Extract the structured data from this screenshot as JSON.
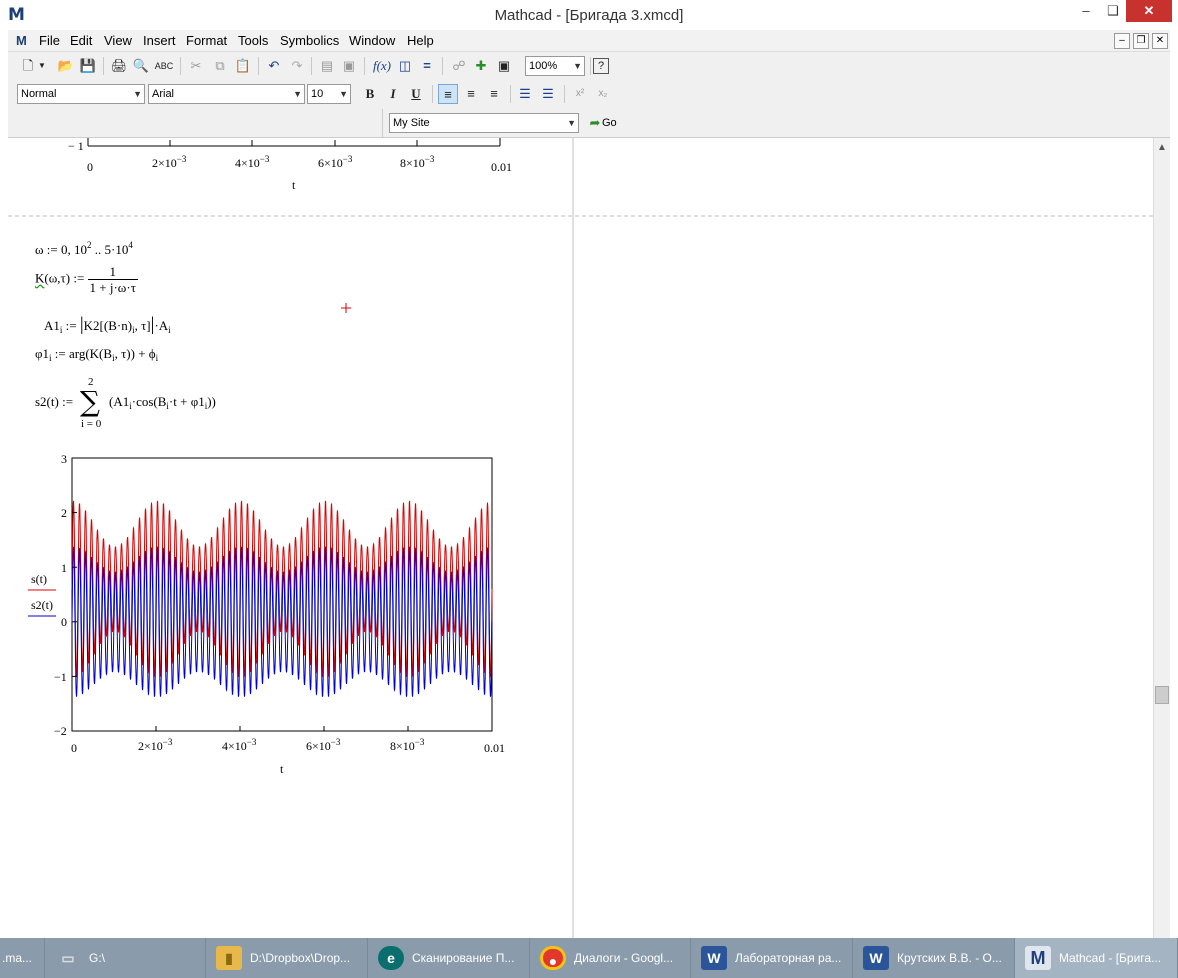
{
  "window": {
    "title": "Mathcad - [Бригада 3.xmcd]",
    "app_icon": "mathcad-m-icon"
  },
  "menu": {
    "items": [
      "File",
      "Edit",
      "View",
      "Insert",
      "Format",
      "Tools",
      "Symbolics",
      "Window",
      "Help"
    ]
  },
  "toolbar": {
    "zoom": "100%",
    "style": "Normal",
    "font": "Arial",
    "size": "10",
    "bold": "B",
    "italic": "I",
    "underline": "U",
    "site": "My Site",
    "go": "Go",
    "superscript": "x²",
    "subscript": "x₂"
  },
  "top_plot": {
    "y_tick": "− 1",
    "x_ticks": [
      {
        "mant": "0",
        "exp": ""
      },
      {
        "mant": "2×10",
        "exp": "−3"
      },
      {
        "mant": "4×10",
        "exp": "−3"
      },
      {
        "mant": "6×10",
        "exp": "−3"
      },
      {
        "mant": "8×10",
        "exp": "−3"
      },
      {
        "mant": "0.01",
        "exp": ""
      }
    ],
    "xlabel": "t"
  },
  "equations": {
    "omega": {
      "lhs": "ω := 0, 10",
      "exp1": "2",
      "mid": " .. 5·10",
      "exp2": "4"
    },
    "K": {
      "lhs": "K",
      "args": "(ω,τ) := ",
      "num": "1",
      "den": "1 + j·ω·τ"
    },
    "A1": {
      "text1": "A1",
      "sub1": "i",
      "text2": " := ",
      "bar_open": "|",
      "text3": "K2[(B·n)",
      "sub2": "i",
      "text4": ", τ]",
      "bar_close": "|",
      "text5": "·A",
      "sub3": "i"
    },
    "phi1": {
      "text1": "φ1",
      "sub1": "i",
      "text2": " := arg(K(B",
      "sub2": "i",
      "text3": ", τ)) + ϕ",
      "sub3": "i"
    },
    "s2": {
      "lhs": "s2(t) := ",
      "upper": "2",
      "sigma": "∑",
      "lower": "i = 0",
      "term1": "(A1",
      "sub1": "i",
      "term2": "·cos(B",
      "sub2": "i",
      "term3": "·t + φ1",
      "sub3": "i",
      "term4": "))"
    }
  },
  "chart_data": {
    "type": "line",
    "xlabel": "t",
    "ylabel_series": [
      "s(t)",
      "s2(t)"
    ],
    "xlim": [
      0,
      0.01
    ],
    "ylim": [
      -2,
      3
    ],
    "x_ticks": [
      {
        "mant": "0",
        "exp": ""
      },
      {
        "mant": "2×10",
        "exp": "−3"
      },
      {
        "mant": "4×10",
        "exp": "−3"
      },
      {
        "mant": "6×10",
        "exp": "−3"
      },
      {
        "mant": "8×10",
        "exp": "−3"
      },
      {
        "mant": "0.01",
        "exp": ""
      }
    ],
    "y_ticks": [
      "3",
      "2",
      "1",
      "0",
      "−1",
      "−2"
    ],
    "series": [
      {
        "name": "s(t)",
        "color": "#e00000",
        "offset": 0.6,
        "carrier_cycles": 70,
        "carrier_amp": 1.2,
        "env_cycles": 5,
        "env_amp": 0.35,
        "env_phase": 1.5
      },
      {
        "name": "s2(t)",
        "color": "#0000cc",
        "offset": 0.0,
        "carrier_cycles": 70,
        "carrier_amp": 1.15,
        "env_cycles": 5,
        "env_amp": 0.2,
        "env_phase": 1.5
      }
    ]
  },
  "taskbar": {
    "items": [
      {
        "label": ".ma...",
        "icon": ""
      },
      {
        "label": "G:\\",
        "icon": "drive-icon"
      },
      {
        "label": "D:\\Dropbox\\Drop...",
        "icon": "folder-icon"
      },
      {
        "label": "Сканирование П...",
        "icon": "eset-icon"
      },
      {
        "label": "Диалоги - Googl...",
        "icon": "chrome-icon"
      },
      {
        "label": "Лабораторная ра...",
        "icon": "word-icon"
      },
      {
        "label": "Крутских В.В. - О...",
        "icon": "word-icon"
      },
      {
        "label": "Mathcad - [Брига...",
        "icon": "mathcad-icon"
      }
    ]
  }
}
